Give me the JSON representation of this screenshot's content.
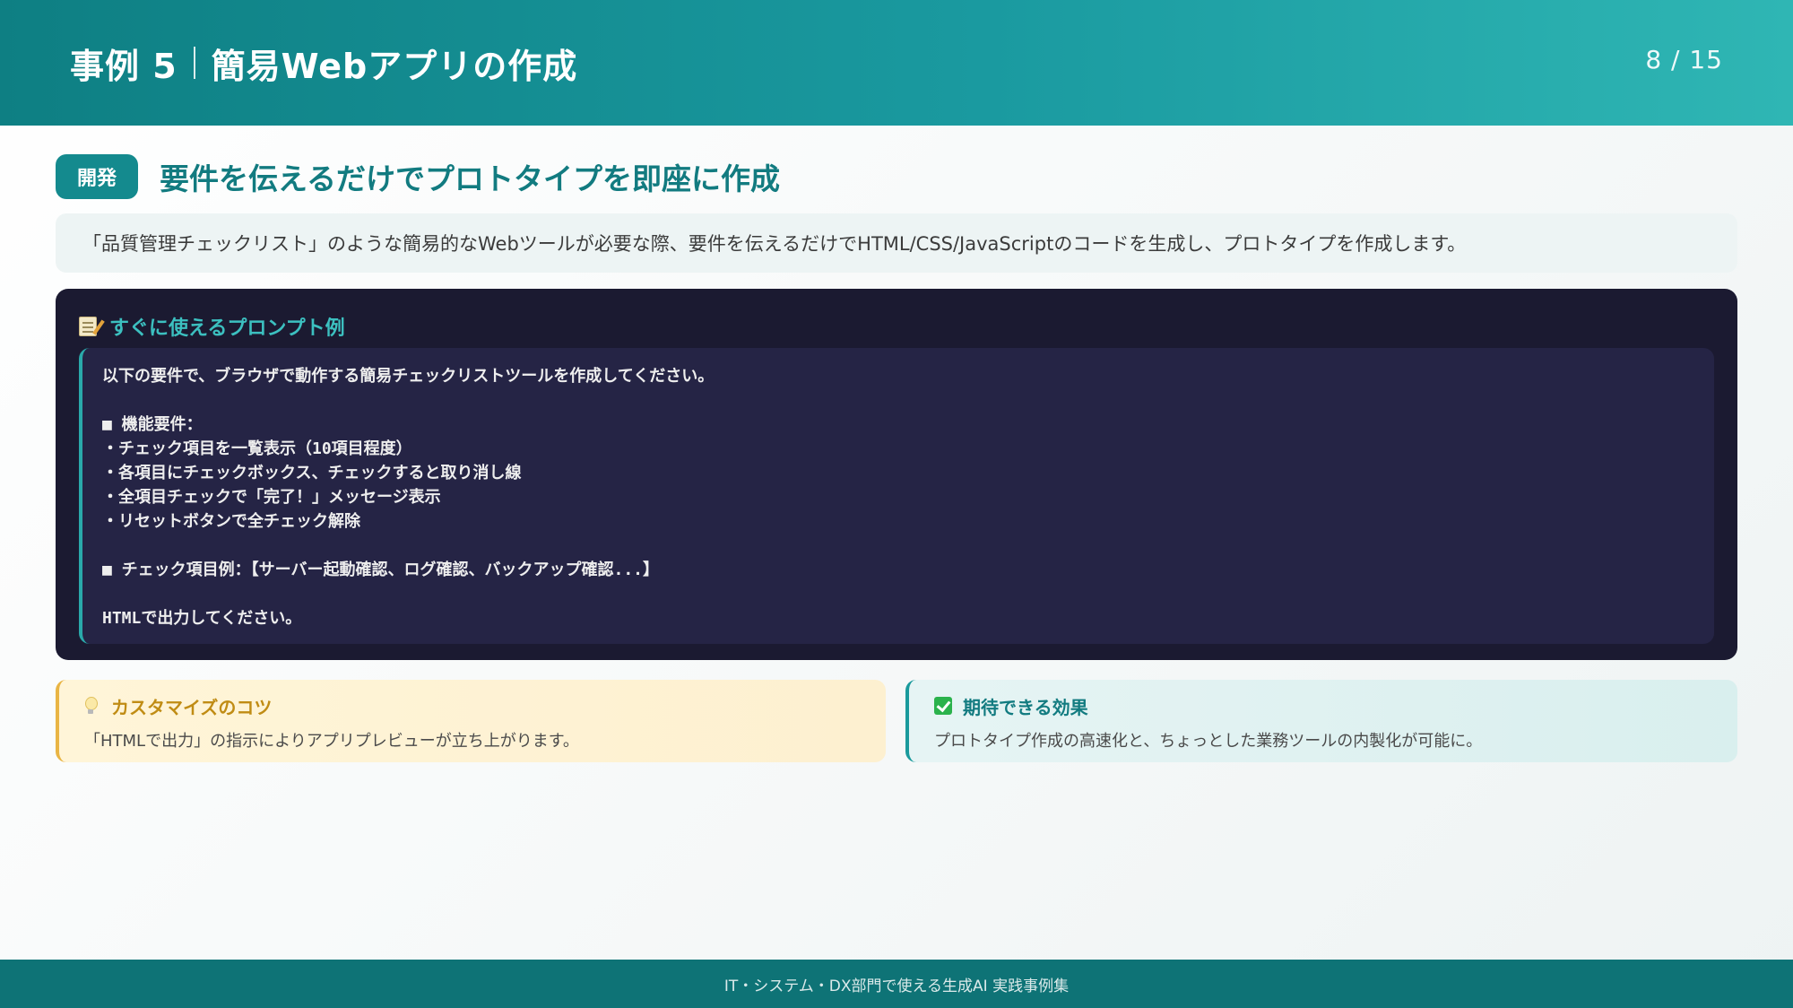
{
  "header": {
    "case_label": "事例 5",
    "title": "簡易Webアプリの作成",
    "page": "8 / 15"
  },
  "section": {
    "badge": "開発",
    "title": "要件を伝えるだけでプロトタイプを即座に作成",
    "description": "「品質管理チェックリスト」のような簡易的なWebツールが必要な際、要件を伝えるだけでHTML/CSS/JavaScriptのコードを生成し、プロトタイプを作成します。"
  },
  "prompt": {
    "icon": "memo-icon",
    "heading": "すぐに使えるプロンプト例",
    "lines": [
      "以下の要件で、ブラウザで動作する簡易チェックリストツールを作成してください。",
      "",
      "■ 機能要件：",
      "・チェック項目を一覧表示（10項目程度）",
      "・各項目にチェックボックス、チェックすると取り消し線",
      "・全項目チェックで「完了！」メッセージ表示",
      "・リセットボタンで全チェック解除",
      "",
      "■ チェック項目例：【サーバー起動確認、ログ確認、バックアップ確認...】",
      "",
      "HTMLで出力してください。"
    ]
  },
  "tips": {
    "customize": {
      "icon": "lightbulb-icon",
      "title": "カスタマイズのコツ",
      "body": "「HTMLで出力」の指示によりアプリプレビューが立ち上がります。"
    },
    "effect": {
      "icon": "check-mark-icon",
      "title": "期待できる効果",
      "body": "プロトタイプ作成の高速化と、ちょっとした業務ツールの内製化が可能に。"
    }
  },
  "footer": {
    "text": "IT・システム・DX部門で使える生成AI 実践事例集"
  },
  "colors": {
    "header_start": "#0e7f83",
    "header_end": "#2fb6b4",
    "accent": "#148a8e",
    "prompt_bg": "#1b1a31",
    "footer_bg": "#0e7376"
  }
}
